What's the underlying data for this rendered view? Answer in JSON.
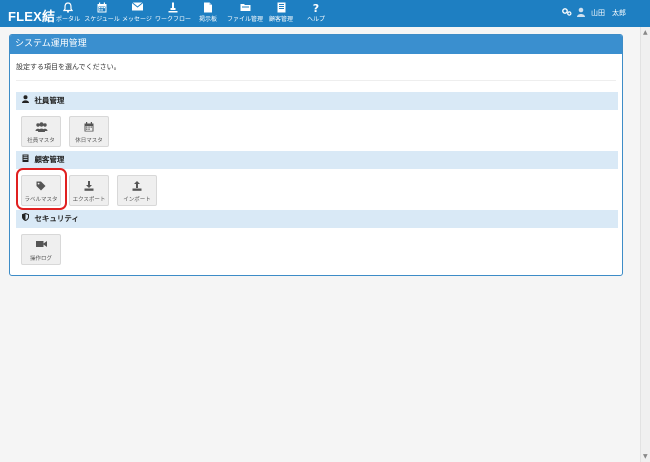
{
  "app": {
    "brand": "FLEX結"
  },
  "nav": [
    {
      "label": "ポータル",
      "icon": "bell-icon"
    },
    {
      "label": "スケジュール",
      "icon": "calendar-icon"
    },
    {
      "label": "メッセージ",
      "icon": "envelope-icon"
    },
    {
      "label": "ワークフロー",
      "icon": "workflow-icon"
    },
    {
      "label": "掲示板",
      "icon": "board-icon"
    },
    {
      "label": "ファイル管理",
      "icon": "folder-icon"
    },
    {
      "label": "顧客管理",
      "icon": "customer-icon"
    },
    {
      "label": "ヘルプ",
      "icon": "help-icon"
    }
  ],
  "user": {
    "name": "山田　太郎"
  },
  "panel": {
    "title": "システム運用管理",
    "description": "設定する項目を選んでください。"
  },
  "sections": [
    {
      "title": "社員管理",
      "icon": "user-icon",
      "tiles": [
        {
          "label": "社員マスタ",
          "icon": "users-icon"
        },
        {
          "label": "休日マスタ",
          "icon": "calendar-icon"
        }
      ]
    },
    {
      "title": "顧客管理",
      "icon": "building-icon",
      "tiles": [
        {
          "label": "ラベルマスタ",
          "icon": "tag-icon"
        },
        {
          "label": "エクスポート",
          "icon": "download-icon"
        },
        {
          "label": "インポート",
          "icon": "upload-icon"
        }
      ]
    },
    {
      "title": "セキュリティ",
      "icon": "shield-icon",
      "tiles": [
        {
          "label": "操作ログ",
          "icon": "video-camera-icon"
        }
      ]
    }
  ],
  "colors": {
    "navbar": "#1e7fc2",
    "panel_header": "#3a8fcf",
    "section_bg": "#d9e9f6",
    "highlight": "#e02020"
  }
}
